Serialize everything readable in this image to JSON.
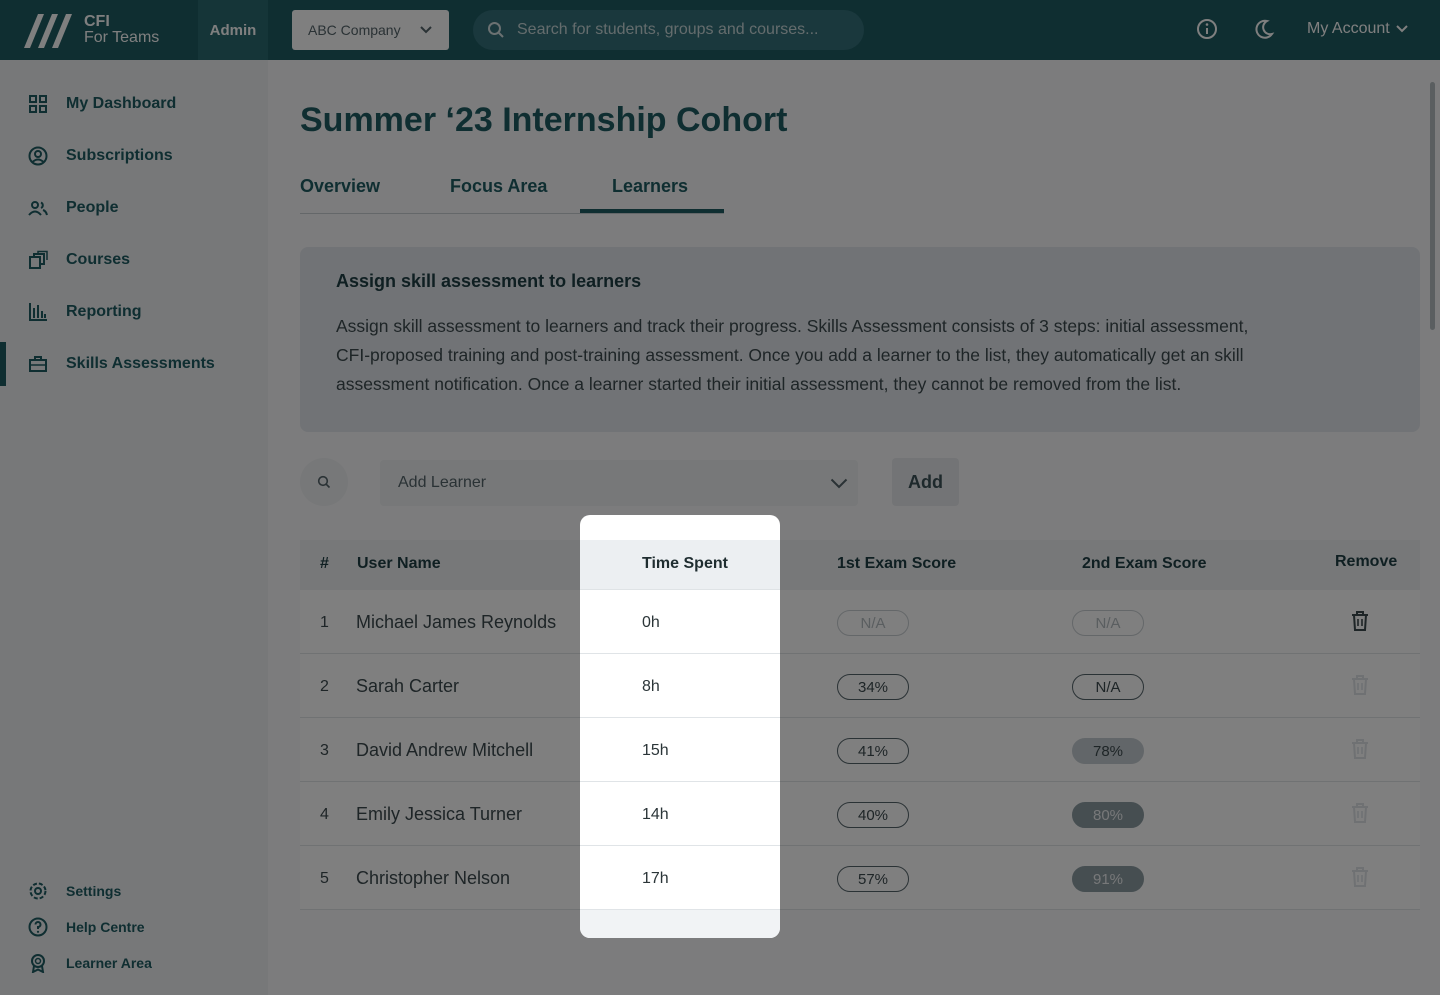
{
  "topbar": {
    "logo_line1": "CFI",
    "logo_line2": "For Teams",
    "admin_label": "Admin",
    "company_selected": "ABC Company",
    "search_placeholder": "Search for students, groups and courses...",
    "account_label": "My Account",
    "icons": [
      "info-icon",
      "moon-icon",
      "chevron-down-icon"
    ]
  },
  "sidebar": {
    "items": [
      {
        "label": "My Dashboard",
        "icon": "dashboard-grid-icon"
      },
      {
        "label": "Subscriptions",
        "icon": "user-circle-icon"
      },
      {
        "label": "People",
        "icon": "people-icon"
      },
      {
        "label": "Courses",
        "icon": "courses-icon"
      },
      {
        "label": "Reporting",
        "icon": "bar-chart-icon"
      },
      {
        "label": "Skills Assessments",
        "icon": "briefcase-icon",
        "active": true
      }
    ],
    "bottom": [
      {
        "label": "Settings",
        "icon": "gear-icon"
      },
      {
        "label": "Help Centre",
        "icon": "help-icon"
      },
      {
        "label": "Learner Area",
        "icon": "award-icon"
      }
    ]
  },
  "page": {
    "title": "Summer ‘23 Internship Cohort",
    "tabs": [
      "Overview",
      "Focus Area",
      "Learners"
    ],
    "active_tab": "Learners"
  },
  "info": {
    "heading": "Assign skill assessment to learners",
    "line1": "Assign skill assessment to learners and track their progress. Skills Assessment consists of 3 steps: initial assessment,",
    "line2": "CFI-proposed training and post-training assessment. Once you add a learner to the list, they automatically get an skill",
    "line3": "assessment notification. Once a learner started their initial assessment, they cannot be removed from the list."
  },
  "add_learner": {
    "placeholder": "Add Learner",
    "button": "Add"
  },
  "table": {
    "columns": [
      "#",
      "User Name",
      "Time Spent",
      "1st Exam Score",
      "2nd Exam Score",
      "Remove"
    ],
    "rows": [
      {
        "num": "1",
        "name": "Michael James Reynolds",
        "time": "0h",
        "exam1": "N/A",
        "exam2": "N/A"
      },
      {
        "num": "2",
        "name": "Sarah Carter",
        "time": "8h",
        "exam1": "34%",
        "exam2": "N/A"
      },
      {
        "num": "3",
        "name": "David Andrew Mitchell",
        "time": "15h",
        "exam1": "41%",
        "exam2": "78%"
      },
      {
        "num": "4",
        "name": "Emily Jessica Turner",
        "time": "14h",
        "exam1": "40%",
        "exam2": "80%"
      },
      {
        "num": "5",
        "name": "Christopher Nelson",
        "time": "17h",
        "exam1": "57%",
        "exam2": "91%"
      }
    ]
  }
}
